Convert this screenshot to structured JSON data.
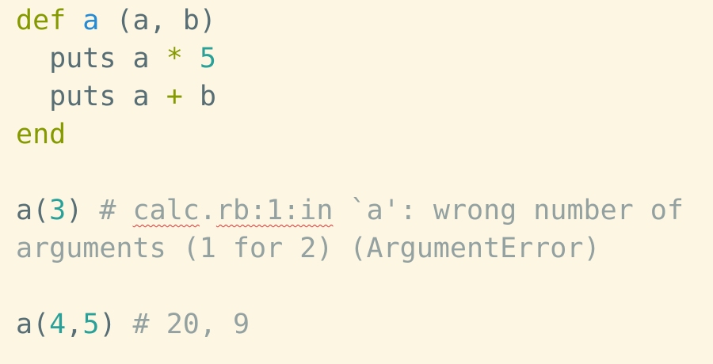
{
  "code": {
    "line1": {
      "kw": "def",
      "name": "a",
      "params": "(a, b)"
    },
    "line2": {
      "indent": "  ",
      "call": "puts",
      "var": "a",
      "op": "*",
      "num": "5"
    },
    "line3": {
      "indent": "  ",
      "call": "puts",
      "var": "a",
      "op": "+",
      "var2": "b"
    },
    "line4": {
      "kw": "end"
    },
    "line6": {
      "call": "a(",
      "num": "3",
      "close": ")",
      "hash": "#",
      "word1": "calc",
      "dot": ".",
      "word2": "rb:1:in",
      "rest": "`a': wrong number of"
    },
    "line7": {
      "text": "arguments (1 for 2) (ArgumentError)"
    },
    "line9": {
      "call": "a(",
      "num1": "4",
      "comma": ",",
      "num2": "5",
      "close": ")",
      "comment": "# 20, 9"
    }
  },
  "colors": {
    "background": "#fdf6e3",
    "keyword": "#859900",
    "function": "#268bd2",
    "number": "#2aa198",
    "text": "#586e75",
    "comment": "#93a1a1",
    "spellcheck": "#dc322f"
  }
}
